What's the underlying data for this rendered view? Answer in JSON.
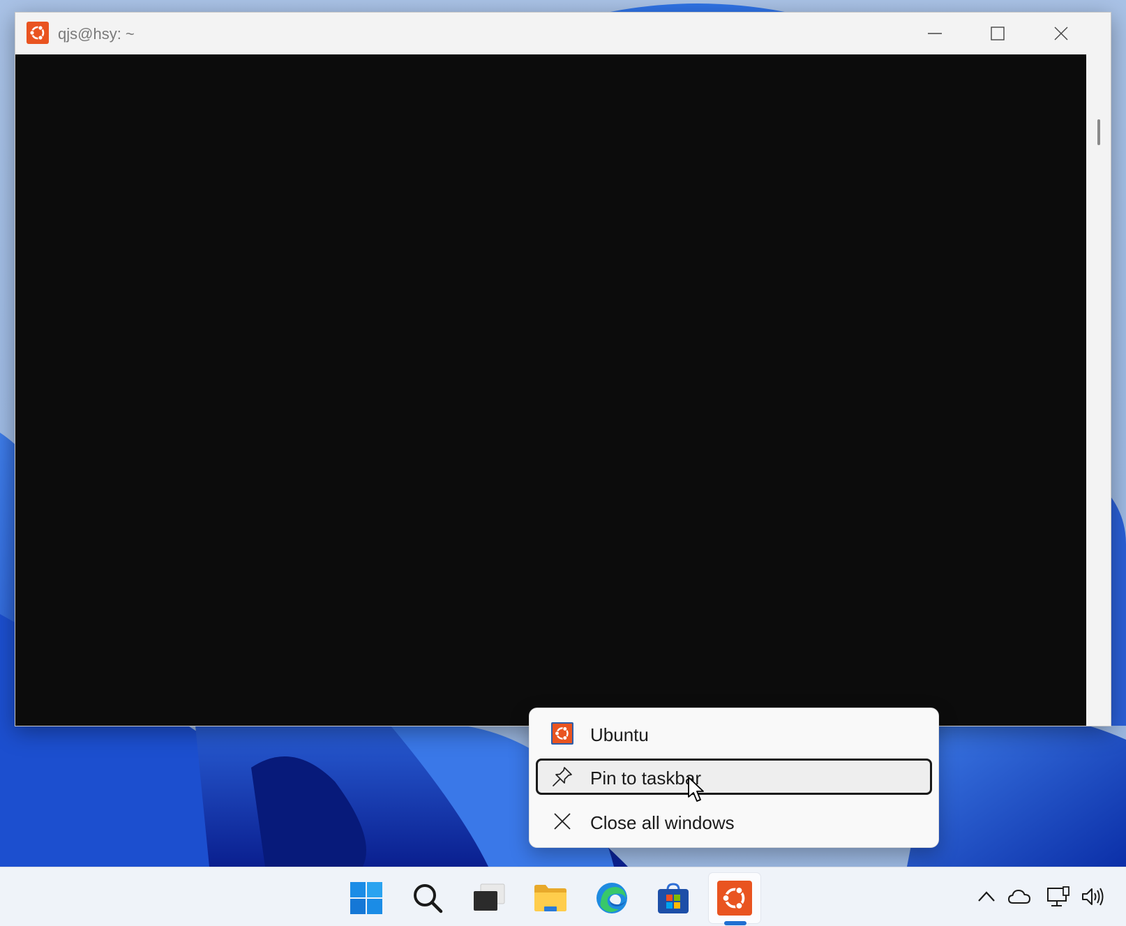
{
  "window": {
    "title": "qjs@hsy: ~",
    "app_icon": "ubuntu-icon",
    "controls": [
      "minimize-icon",
      "maximize-icon",
      "close-icon"
    ]
  },
  "context_menu": {
    "header_label": "Ubuntu",
    "items": [
      {
        "label": "Pin to taskbar",
        "icon": "pin-icon",
        "highlighted": true
      },
      {
        "label": "Close all windows",
        "icon": "close-icon"
      }
    ]
  },
  "taskbar": {
    "apps": [
      {
        "name": "start",
        "icon": "windows-start-icon"
      },
      {
        "name": "search",
        "icon": "search-icon"
      },
      {
        "name": "task-view",
        "icon": "task-view-icon"
      },
      {
        "name": "file-explorer",
        "icon": "folder-icon"
      },
      {
        "name": "edge",
        "icon": "edge-browser-icon"
      },
      {
        "name": "store",
        "icon": "store-icon"
      },
      {
        "name": "ubuntu",
        "icon": "ubuntu-icon",
        "active": true
      }
    ],
    "tray": [
      "chevron-up-icon",
      "cloud-icon",
      "network-icon",
      "volume-icon"
    ]
  },
  "colors": {
    "ubuntu_orange": "#e95420",
    "terminal_bg": "#0c0c0c",
    "accent": "#1f6fd1"
  }
}
